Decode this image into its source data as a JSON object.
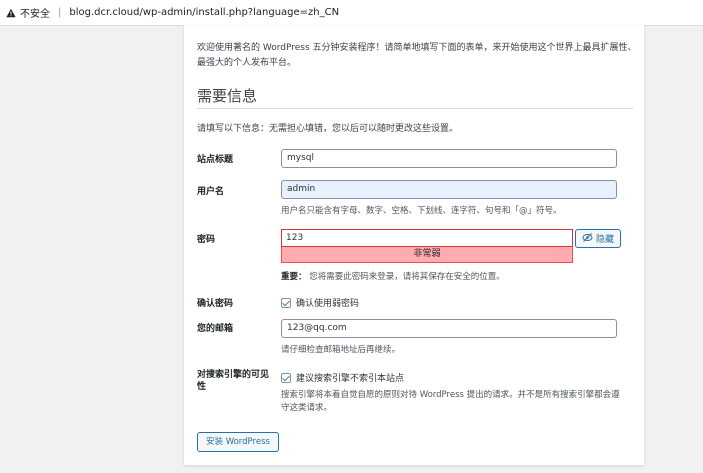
{
  "browser": {
    "security_text": "不安全",
    "separator": "|",
    "url": "blog.dcr.cloud/wp-admin/install.php?language=zh_CN"
  },
  "install": {
    "intro": "欢迎使用著名的 WordPress 五分钟安装程序！请简单地填写下面的表单，来开始使用这个世界上最具扩展性、最强大的个人发布平台。",
    "heading": "需要信息",
    "subtext": "请填写以下信息：无需担心填错，您以后可以随时更改这些设置。",
    "site_title": {
      "label": "站点标题",
      "value": "mysql"
    },
    "username": {
      "label": "用户名",
      "value": "admin",
      "help": "用户名只能含有字母、数字、空格、下划线、连字符、句号和「@」符号。"
    },
    "password": {
      "label": "密码",
      "value": "123",
      "strength": "非常弱",
      "hide_label": "隐藏",
      "important_label": "重要：",
      "important_text": "您将需要此密码来登录，请将其保存在安全的位置。"
    },
    "confirm_password": {
      "label": "确认密码",
      "checkbox_label": "确认使用弱密码"
    },
    "email": {
      "label": "您的邮箱",
      "value": "123@qq.com",
      "help": "请仔细检查邮箱地址后再继续。"
    },
    "search_visibility": {
      "label": "对搜索引擎的可见性",
      "checkbox_label": "建议搜索引擎不索引本站点",
      "help": "搜索引擎将本着自觉自愿的原则对待 WordPress 提出的请求。并不是所有搜索引擎都会遵守这类请求。"
    },
    "submit_label": "安装 WordPress"
  },
  "colors": {
    "accent": "#2271b1",
    "weak_bg": "#ffabaf",
    "error_border": "#d63638",
    "autofill_bg": "#e8f0fe"
  },
  "icons": [
    "warning-icon",
    "eye-slash-icon",
    "checkmark-icon"
  ]
}
